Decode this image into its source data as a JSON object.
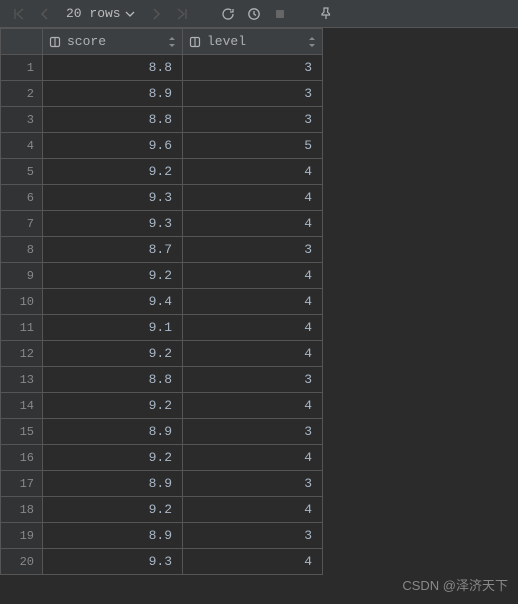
{
  "toolbar": {
    "rows_label": "20 rows"
  },
  "columns": [
    {
      "label": "score"
    },
    {
      "label": "level"
    }
  ],
  "rows": [
    {
      "n": "1",
      "score": "8.8",
      "level": "3"
    },
    {
      "n": "2",
      "score": "8.9",
      "level": "3"
    },
    {
      "n": "3",
      "score": "8.8",
      "level": "3"
    },
    {
      "n": "4",
      "score": "9.6",
      "level": "5"
    },
    {
      "n": "5",
      "score": "9.2",
      "level": "4"
    },
    {
      "n": "6",
      "score": "9.3",
      "level": "4"
    },
    {
      "n": "7",
      "score": "9.3",
      "level": "4"
    },
    {
      "n": "8",
      "score": "8.7",
      "level": "3"
    },
    {
      "n": "9",
      "score": "9.2",
      "level": "4"
    },
    {
      "n": "10",
      "score": "9.4",
      "level": "4"
    },
    {
      "n": "11",
      "score": "9.1",
      "level": "4"
    },
    {
      "n": "12",
      "score": "9.2",
      "level": "4"
    },
    {
      "n": "13",
      "score": "8.8",
      "level": "3"
    },
    {
      "n": "14",
      "score": "9.2",
      "level": "4"
    },
    {
      "n": "15",
      "score": "8.9",
      "level": "3"
    },
    {
      "n": "16",
      "score": "9.2",
      "level": "4"
    },
    {
      "n": "17",
      "score": "8.9",
      "level": "3"
    },
    {
      "n": "18",
      "score": "9.2",
      "level": "4"
    },
    {
      "n": "19",
      "score": "8.9",
      "level": "3"
    },
    {
      "n": "20",
      "score": "9.3",
      "level": "4"
    }
  ],
  "watermark": "CSDN @泽济天下",
  "chart_data": {
    "type": "table",
    "title": "",
    "columns": [
      "score",
      "level"
    ],
    "rows": [
      [
        8.8,
        3
      ],
      [
        8.9,
        3
      ],
      [
        8.8,
        3
      ],
      [
        9.6,
        5
      ],
      [
        9.2,
        4
      ],
      [
        9.3,
        4
      ],
      [
        9.3,
        4
      ],
      [
        8.7,
        3
      ],
      [
        9.2,
        4
      ],
      [
        9.4,
        4
      ],
      [
        9.1,
        4
      ],
      [
        9.2,
        4
      ],
      [
        8.8,
        3
      ],
      [
        9.2,
        4
      ],
      [
        8.9,
        3
      ],
      [
        9.2,
        4
      ],
      [
        8.9,
        3
      ],
      [
        9.2,
        4
      ],
      [
        8.9,
        3
      ],
      [
        9.3,
        4
      ]
    ]
  }
}
